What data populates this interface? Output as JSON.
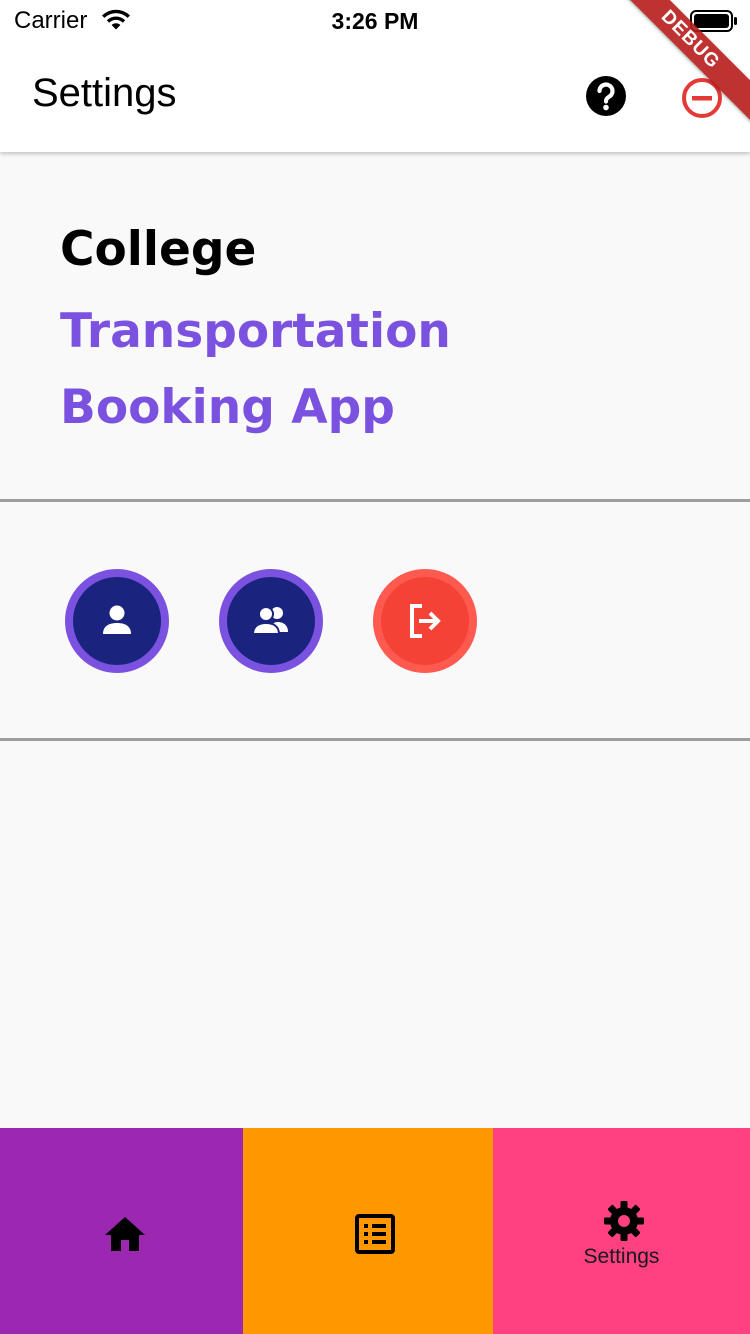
{
  "status_bar": {
    "carrier": "Carrier",
    "time": "3:26 PM"
  },
  "debug_banner": {
    "label": "DEBUG",
    "color": "#b71c1c"
  },
  "app_bar": {
    "title": "Settings",
    "actions": [
      {
        "icon": "help-icon"
      },
      {
        "icon": "remove-circle-icon",
        "color": "#e53935"
      }
    ]
  },
  "header": {
    "line1": "College",
    "line2": "Transportation",
    "line3": "Booking App",
    "accent_color": "#7b52e0"
  },
  "actions": [
    {
      "icon": "person-icon",
      "background": "#1a237e",
      "ring": "#7b52e0"
    },
    {
      "icon": "group-icon",
      "background": "#1a237e",
      "ring": "#7b52e0"
    },
    {
      "icon": "exit-icon",
      "background": "#f44336",
      "ring": "#ff5a50"
    }
  ],
  "bottom_nav": {
    "items": [
      {
        "icon": "home-icon",
        "label": "",
        "background": "#9c27b0"
      },
      {
        "icon": "list-icon",
        "label": "",
        "background": "#ff9800"
      },
      {
        "icon": "gear-icon",
        "label": "Settings",
        "background": "#ff4081",
        "selected": true
      }
    ]
  }
}
